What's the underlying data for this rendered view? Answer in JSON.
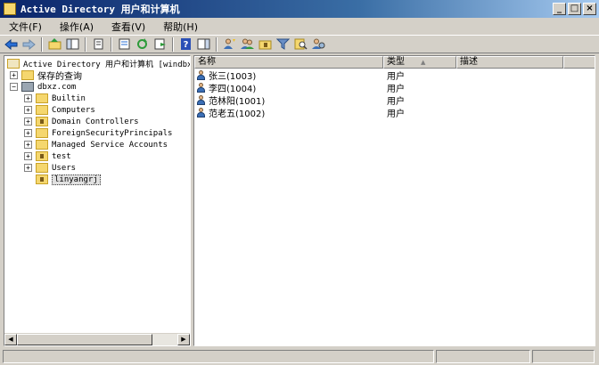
{
  "window": {
    "title": "Active Directory 用户和计算机",
    "controls": {
      "minimize": "_",
      "maximize": "□",
      "close": "×"
    }
  },
  "menu": [
    {
      "label": "文件(F)"
    },
    {
      "label": "操作(A)"
    },
    {
      "label": "查看(V)"
    },
    {
      "label": "帮助(H)"
    }
  ],
  "toolbar": [
    "back-arrow-icon",
    "forward-arrow-icon",
    "up-folder-icon",
    "show-hide-tree-icon",
    "copy-icon",
    "properties-icon",
    "refresh-icon",
    "export-list-icon",
    "help-icon",
    "action-pane-icon",
    "add-user-icon",
    "add-group-icon",
    "add-ou-icon",
    "filter-icon",
    "find-icon",
    "add-to-group-icon"
  ],
  "tree": {
    "root": "Active Directory 用户和计算机 [windbxz",
    "saved_queries": "保存的查询",
    "domain": "dbxz.com",
    "items": [
      {
        "label": "Builtin",
        "expander": "+"
      },
      {
        "label": "Computers",
        "expander": "+"
      },
      {
        "label": "Domain Controllers",
        "expander": "+"
      },
      {
        "label": "ForeignSecurityPrincipals",
        "expander": "+"
      },
      {
        "label": "Managed Service Accounts",
        "expander": "+"
      },
      {
        "label": "test",
        "expander": "+"
      },
      {
        "label": "Users",
        "expander": "+"
      },
      {
        "label": "linyangrj",
        "expander": ""
      }
    ],
    "selected": "linyangrj"
  },
  "list": {
    "columns": {
      "name": "名称",
      "type": "类型",
      "description": "描述"
    },
    "rows": [
      {
        "name": "张三(1003)",
        "type": "用户"
      },
      {
        "name": "李四(1004)",
        "type": "用户"
      },
      {
        "name": "范林阳(1001)",
        "type": "用户"
      },
      {
        "name": "范老五(1002)",
        "type": "用户"
      }
    ]
  },
  "colors": {
    "titlebar_start": "#0a246a",
    "titlebar_end": "#a6caf0",
    "chrome": "#d4d0c8",
    "folder": "#f5d76e"
  }
}
